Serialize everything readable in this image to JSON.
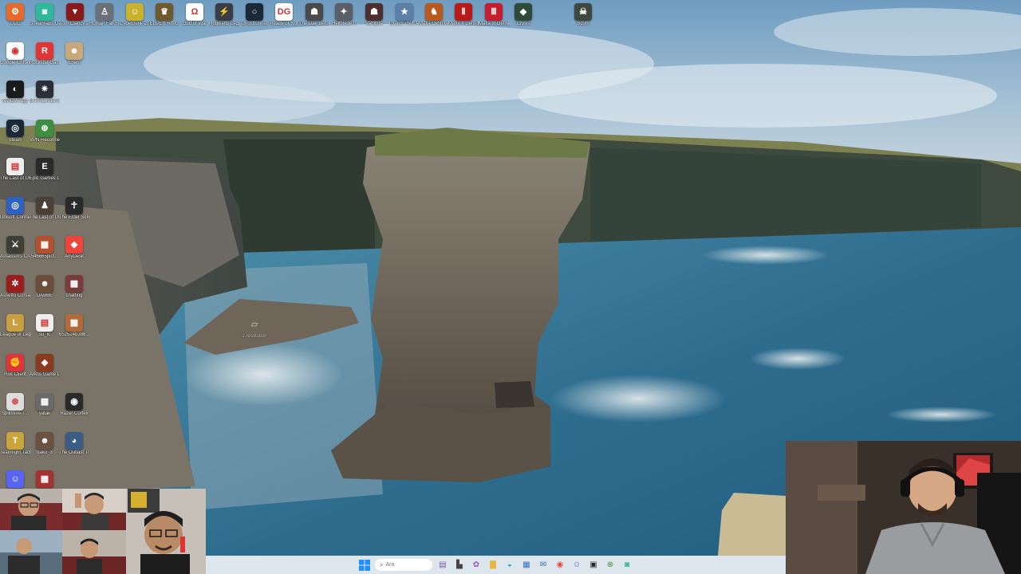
{
  "desktop": {
    "icons_top_row": [
      {
        "label": "CCC",
        "icon": "app-icon",
        "color": "#e56a2b",
        "symbol": "⚙"
      },
      {
        "label": "Streamlabs Desktop",
        "icon": "streamlabs-icon",
        "color": "#2fb89a",
        "symbol": "◙"
      },
      {
        "label": "Tom Clancy's Rainbow...",
        "icon": "rainbow-six-icon",
        "color": "#8a1a1a",
        "symbol": "▼"
      },
      {
        "label": "Human Fall Flat",
        "icon": "game-icon",
        "color": "#6b6f78",
        "symbol": "♙"
      },
      {
        "label": "Cyberpunk 2077",
        "icon": "cyberpunk-icon",
        "color": "#c9b22e",
        "symbol": "☺"
      },
      {
        "label": "ELDEN RING",
        "icon": "elden-ring-icon",
        "color": "#6e5a2d",
        "symbol": "♛"
      },
      {
        "label": "God of War",
        "icon": "god-of-war-icon",
        "color": "#ffffff",
        "symbol": "Ω"
      },
      {
        "label": "Hogwarts Legacy",
        "icon": "game-icon",
        "color": "#3a3d46",
        "symbol": "⚡"
      },
      {
        "label": "Ghostrunner",
        "icon": "game-icon",
        "color": "#1b2836",
        "symbol": "○"
      },
      {
        "label": "Ready or Not",
        "icon": "game-icon",
        "color": "#ffffff",
        "symbol": "DG"
      },
      {
        "label": "The Day Before",
        "icon": "game-icon",
        "color": "#4a4a4a",
        "symbol": "☗"
      },
      {
        "label": "Hellblade II",
        "icon": "game-icon",
        "color": "#5a5e66",
        "symbol": "✦"
      },
      {
        "label": "Vampire",
        "icon": "game-icon",
        "color": "#4d2f2f",
        "symbol": "☗"
      },
      {
        "label": "Grand Theft Auto V",
        "icon": "gta-icon",
        "color": "#5c7fa8",
        "symbol": "★"
      },
      {
        "label": "Mafia Definitive...",
        "icon": "game-icon",
        "color": "#b8591f",
        "symbol": "♞"
      },
      {
        "label": "Mafia II Definitive...",
        "icon": "game-icon",
        "color": "#b81a1a",
        "symbol": "Ⅱ"
      },
      {
        "label": "Mafia III Definitive...",
        "icon": "game-icon",
        "color": "#c41f2e",
        "symbol": "Ⅲ"
      },
      {
        "label": "Crysis",
        "icon": "game-icon",
        "color": "#2e4a3a",
        "symbol": "◆"
      },
      {
        "label": "Scum",
        "icon": "game-icon",
        "color": "#3e4840",
        "symbol": "☠"
      }
    ],
    "icons_left_columns": [
      {
        "label": "Google Chrome",
        "icon": "chrome-icon",
        "color": "#ffffff",
        "symbol": "◉"
      },
      {
        "label": "Rockstar Games...",
        "icon": "rockstar-icon",
        "color": "#e23434",
        "symbol": "R"
      },
      {
        "label": "Eneril",
        "icon": "image-file-icon",
        "color": "#c7a87a",
        "symbol": "☻"
      },
      {
        "label": "NVIDIA App",
        "icon": "nvidia-icon",
        "color": "#1b1b1b",
        "symbol": "◐"
      },
      {
        "label": "S.T.A.L.K.E.R. 2",
        "icon": "game-icon",
        "color": "#2b2f3a",
        "symbol": "✷"
      },
      {
        "label": "Steam",
        "icon": "steam-icon",
        "color": "#1b2838",
        "symbol": "◎"
      },
      {
        "label": "VPN Reconnect",
        "icon": "vpn-icon",
        "color": "#3e8e41",
        "symbol": "⊕"
      },
      {
        "label": "The Last of Us...",
        "icon": "file-icon",
        "color": "#eeeeee",
        "symbol": "▤"
      },
      {
        "label": "Epic Games Launcher",
        "icon": "epic-games-icon",
        "color": "#2a2a2a",
        "symbol": "E"
      },
      {
        "label": "Ubisoft Connect",
        "icon": "ubisoft-icon",
        "color": "#2d62c2",
        "symbol": "◎"
      },
      {
        "label": "The Last of Us™ Part I",
        "icon": "game-icon",
        "color": "#4a4035",
        "symbol": "♟"
      },
      {
        "label": "The Elder Scrolls",
        "icon": "elder-scrolls-icon",
        "color": "#2a2a2a",
        "symbol": "☥"
      },
      {
        "label": "Assassin's Creed V...",
        "icon": "game-icon",
        "color": "#3d3f36",
        "symbol": "⚔"
      },
      {
        "label": "546665pict...",
        "icon": "image-file-icon",
        "color": "#b5502e",
        "symbol": "▦"
      },
      {
        "label": "AnyDesk",
        "icon": "anydesk-icon",
        "color": "#ef443b",
        "symbol": "◆"
      },
      {
        "label": "Assetto Corsa",
        "icon": "game-icon",
        "color": "#9c1d1d",
        "symbol": "✲"
      },
      {
        "label": "DABBE",
        "icon": "image-file-icon",
        "color": "#6b4e3a",
        "symbol": "☻"
      },
      {
        "label": "chatting",
        "icon": "image-file-icon",
        "color": "#7a3b3b",
        "symbol": "▦"
      },
      {
        "label": "League of Legends",
        "icon": "league-icon",
        "color": "#c8a041",
        "symbol": "L"
      },
      {
        "label": "su_ic",
        "icon": "file-icon",
        "color": "#eeeeee",
        "symbol": "▤"
      },
      {
        "label": "652524b386...",
        "icon": "image-file-icon",
        "color": "#b06b3a",
        "symbol": "▦"
      },
      {
        "label": "Riot Client",
        "icon": "riot-icon",
        "color": "#e0343b",
        "symbol": "✊"
      },
      {
        "label": "Arktis Game Launcher",
        "icon": "game-icon",
        "color": "#8a3b1f",
        "symbol": "◈"
      },
      {
        "label": "SplitWire-T...",
        "icon": "splitwire-icon",
        "color": "#dddddd",
        "symbol": "⊛"
      },
      {
        "label": "yatak",
        "icon": "image-file-icon",
        "color": "#6a6a6a",
        "symbol": "▦"
      },
      {
        "label": "Razer Cortex",
        "icon": "razer-icon",
        "color": "#2a2a2a",
        "symbol": "◉"
      },
      {
        "label": "Teamfight Tactics",
        "icon": "tft-icon",
        "color": "#c9a53b",
        "symbol": "T"
      },
      {
        "label": "bako_3",
        "icon": "image-file-icon",
        "color": "#6a5142",
        "symbol": "☻"
      },
      {
        "label": "The Outlast Trials",
        "icon": "game-icon",
        "color": "#3a5d86",
        "symbol": "◕"
      },
      {
        "label": "Discord",
        "icon": "discord-icon",
        "color": "#5865f2",
        "symbol": "☺"
      },
      {
        "label": "",
        "icon": "image-file-icon",
        "color": "#a33232",
        "symbol": "▦"
      }
    ],
    "loose_icon": {
      "label": "2.resolution",
      "icon": "folder-icon"
    }
  },
  "taskbar": {
    "search_placeholder": "Ara",
    "apps": [
      {
        "icon": "windows-start-icon",
        "color": "#1e90ff",
        "symbol": "⊞"
      },
      {
        "icon": "search-icon",
        "color": "#555555",
        "symbol": "⌕"
      },
      {
        "icon": "widgets-icon",
        "color": "#7a5aa8",
        "symbol": "▤"
      },
      {
        "icon": "taskview-icon",
        "color": "#444444",
        "symbol": "▙"
      },
      {
        "icon": "copilot-icon",
        "color": "#8f5ac8",
        "symbol": "✿"
      },
      {
        "icon": "file-explorer-icon",
        "color": "#e7b740",
        "symbol": "▇"
      },
      {
        "icon": "edge-icon",
        "color": "#1d9bd6",
        "symbol": "◒"
      },
      {
        "icon": "store-icon",
        "color": "#2c6cc4",
        "symbol": "▦"
      },
      {
        "icon": "mail-icon",
        "color": "#1f6fc4",
        "symbol": "✉"
      },
      {
        "icon": "chrome-icon",
        "color": "#e8453c",
        "symbol": "◉"
      },
      {
        "icon": "discord-icon",
        "color": "#5865f2",
        "symbol": "☺"
      },
      {
        "icon": "spotify-icon",
        "color": "#2a2a2a",
        "symbol": "▣"
      },
      {
        "icon": "xbox-icon",
        "color": "#4b8f3a",
        "symbol": "⊗"
      },
      {
        "icon": "streamlabs-icon",
        "color": "#2fb89a",
        "symbol": "◙"
      }
    ]
  },
  "overlays": {
    "webcam_grid": {
      "label": "participants-video-grid"
    },
    "webcam_main": {
      "label": "streamer-webcam"
    }
  }
}
